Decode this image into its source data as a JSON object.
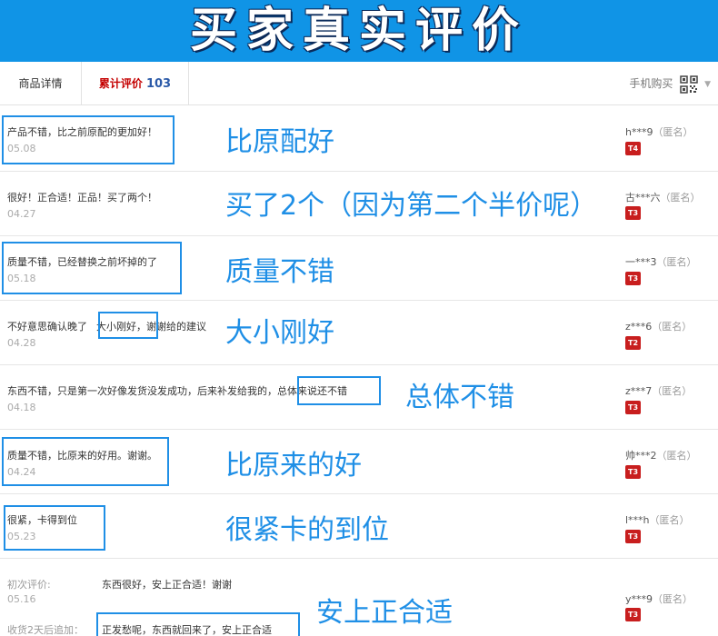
{
  "banner": {
    "title": "买家真实评价"
  },
  "tabs": {
    "details": "商品详情",
    "reviews_label": "累计评价",
    "reviews_count": "103",
    "mobile_buy": "手机购买"
  },
  "reviews": [
    {
      "text": "产品不错，比之前原配的更加好！",
      "date": "05.08",
      "user": "h***9",
      "anon": "（匿名）",
      "badge": "T4",
      "annotation": "比原配好"
    },
    {
      "text": "很好！正合适！正品！买了两个！",
      "date": "04.27",
      "user": "古***六",
      "anon": "（匿名）",
      "badge": "T3",
      "annotation": "买了2个（因为第二个半价呢）"
    },
    {
      "text": "质量不错，已经替换之前坏掉的了",
      "date": "05.18",
      "user": "一***3",
      "anon": "（匿名）",
      "badge": "T3",
      "annotation": "质量不错"
    },
    {
      "text_a": "不好意思确认晚了",
      "text_b": "大小刚好",
      "text_c": "，谢谢给的建议",
      "date": "04.28",
      "user": "z***6",
      "anon": "（匿名）",
      "badge": "T2",
      "annotation": "大小刚好"
    },
    {
      "text_a": "东西不错，只是第一次好像发货没发成功，后来补发给我的，",
      "text_b": "总体来说还不错",
      "date": "04.18",
      "user": "z***7",
      "anon": "（匿名）",
      "badge": "T3",
      "annotation": "总体不错"
    },
    {
      "text": "质量不错，比原来的好用。谢谢。",
      "date": "04.24",
      "user": "帅***2",
      "anon": "（匿名）",
      "badge": "T3",
      "annotation": "比原来的好"
    },
    {
      "text": "很紧，卡得到位",
      "date": "05.23",
      "user": "l***h",
      "anon": "（匿名）",
      "badge": "T3",
      "annotation": "很紧卡的到位"
    },
    {
      "first_label": "初次评价:",
      "text": "东西很好，安上正合适！谢谢",
      "date": "05.16",
      "user": "y***9",
      "anon": "（匿名）",
      "badge": "T3",
      "annotation": "安上正合适",
      "followup_label": "收货2天后追加：",
      "followup_text": "正发愁呢，东西就回来了，安上正合适"
    }
  ]
}
